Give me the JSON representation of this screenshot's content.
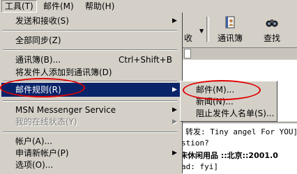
{
  "menubar": {
    "tools": "工具(T)",
    "mail": "邮件(M)",
    "help": "帮助(H)"
  },
  "toolbar": {
    "partial_label": "收",
    "contacts": "通讯簿",
    "find": "查找"
  },
  "tools_menu": {
    "send_receive": "发送和接收(S)",
    "sync_all": "全部同步(Z)",
    "address_book": "通讯簿(B)...",
    "address_book_shortcut": "Ctrl+Shift+B",
    "add_sender": "将发件人添加到通讯簿(D)",
    "message_rules": "邮件规则(R)",
    "msn_messenger": "MSN Messenger Service",
    "my_status": "我的在线状态(Y)",
    "accounts": "帐户(A)...",
    "new_account": "申请新帐户(P)",
    "options": "选项(O)..."
  },
  "rules_submenu": {
    "mail": "邮件(M)...",
    "news": "新闻(N)...",
    "blocked_senders": "阻止发件人名单(S)..."
  },
  "preview": {
    "line1": "转发: Tiny angel For YOU]",
    "line2": "stion?",
    "line3": "床休闲用品  ::北京::2001.0",
    "line4": "ad: fyi]"
  },
  "colors": {
    "selection": "#0a246a",
    "annotation": "#e00000",
    "face": "#d4d0c8"
  }
}
